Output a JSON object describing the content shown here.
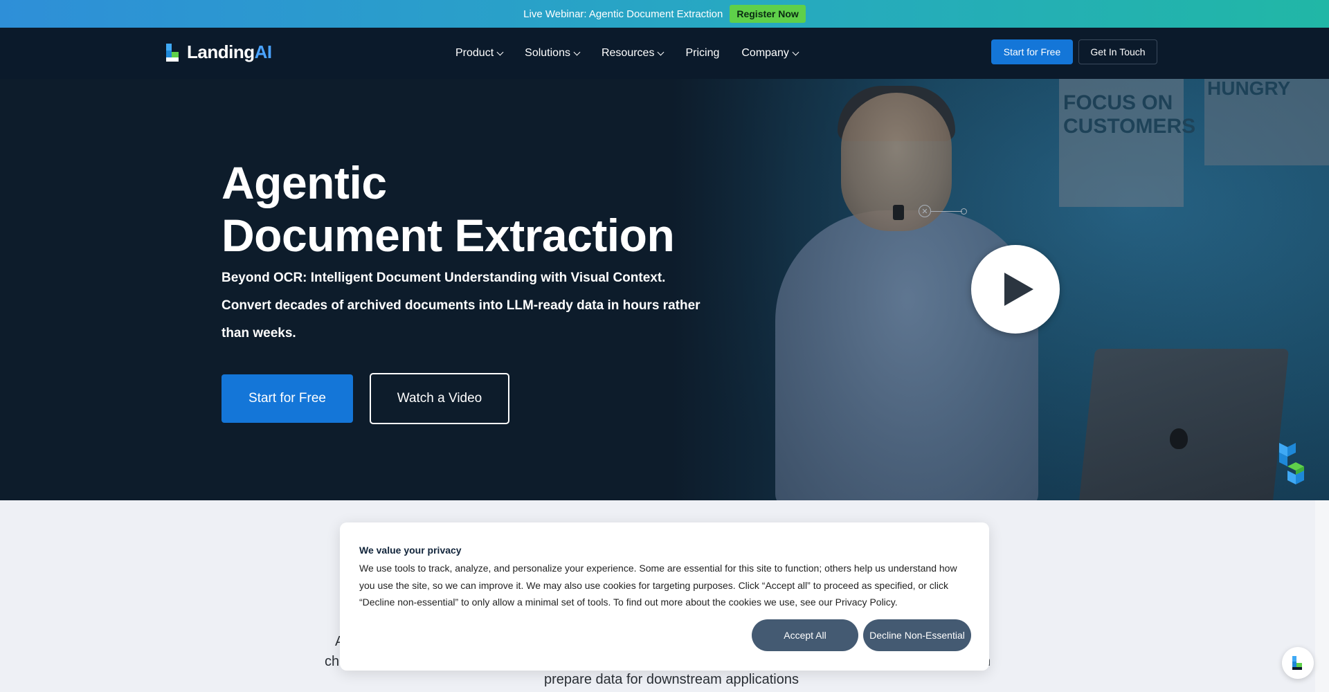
{
  "banner": {
    "text": "Live Webinar: Agentic Document Extraction",
    "cta": "Register Now"
  },
  "nav": {
    "logo_text_main": "Landing",
    "logo_text_accent": "AI",
    "items": [
      {
        "label": "Product",
        "has_dropdown": true
      },
      {
        "label": "Solutions",
        "has_dropdown": true
      },
      {
        "label": "Resources",
        "has_dropdown": true
      },
      {
        "label": "Pricing",
        "has_dropdown": false
      },
      {
        "label": "Company",
        "has_dropdown": true
      }
    ],
    "primary_cta": "Start for Free",
    "secondary_cta": "Get In Touch"
  },
  "hero": {
    "title_line1": "Agentic",
    "title_line2": "Document Extraction",
    "subtitle_line1": "Beyond OCR: Intelligent Document Understanding with Visual Context.",
    "subtitle_line2": "Convert decades of archived documents into LLM-ready data in hours rather",
    "subtitle_line3": "than weeks.",
    "primary_cta": "Start for Free",
    "secondary_cta": "Watch a Video",
    "video_poster_text_1": "FOCUS ON CUSTOMERS",
    "video_poster_text_2": "HUNGRY"
  },
  "below": {
    "frag_a": "A",
    "frag_ch": "ch",
    "frag_n": "n",
    "line_visible": "prepare data for downstream applications"
  },
  "cookie": {
    "title": "We value your privacy",
    "body": "We use tools to track, analyze, and personalize your experience. Some are essential for this site to function; others help us understand how you use the site, so we can improve it. We may also use cookies for targeting purposes. Click “Accept all” to proceed as specified, or click “Decline non-essential” to only allow a minimal set of tools. To find out more about the cookies we use, see our Privacy Policy.",
    "accept_label": "Accept All",
    "decline_label": "Decline Non-Essential"
  },
  "colors": {
    "brand_blue": "#1476d8",
    "nav_bg": "#0b1a2b",
    "register_green": "#5fd04a",
    "cookie_button": "#445a72"
  }
}
